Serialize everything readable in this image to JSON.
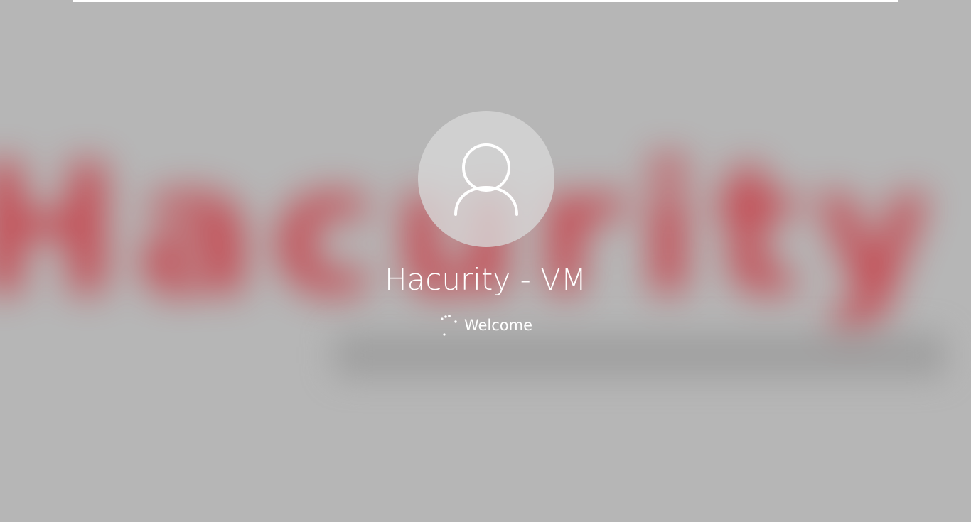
{
  "login": {
    "avatar_icon": "user-silhouette-icon",
    "username": "Hacurity - VM",
    "status_text": "Welcome",
    "spinner_icon": "loading-dots-icon"
  },
  "wallpaper": {
    "background_text": "Hacurity",
    "accent_color": "#c8303a",
    "background_color": "#b6b6b6"
  }
}
